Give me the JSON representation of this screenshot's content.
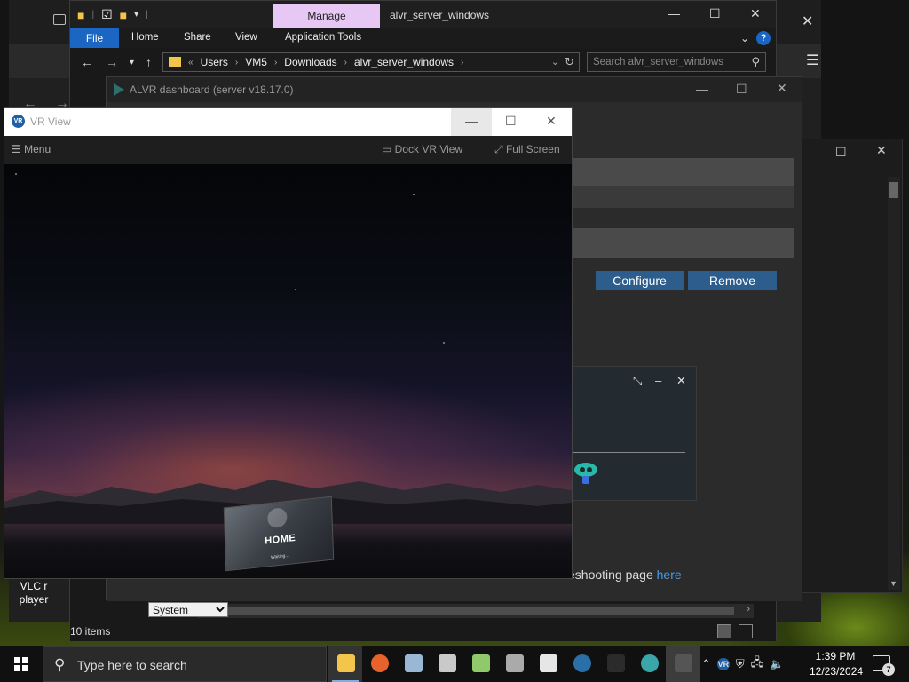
{
  "explorer": {
    "manage_tab": "Manage",
    "title": "alvr_server_windows",
    "ribbon": {
      "file": "File",
      "home": "Home",
      "share": "Share",
      "view": "View",
      "application_tools": "Application Tools"
    },
    "breadcrumbs": [
      "Users",
      "VM5",
      "Downloads",
      "alvr_server_windows"
    ],
    "search_placeholder": "Search alvr_server_windows",
    "status": "10 items"
  },
  "alvr": {
    "title": "ALVR dashboard (server v18.17.0)",
    "configure_label": "Configure",
    "remove_label": "Remove",
    "trouble_prefix": "eshooting page ",
    "trouble_link": "here",
    "language_value": "System"
  },
  "vr_view": {
    "title": "VR View",
    "menu_label": "Menu",
    "dock_label": "Dock VR View",
    "fullscreen_label": "Full Screen",
    "home_label": "HOME",
    "waiting_label": "Waiting..."
  },
  "desktop": {
    "vlc_label_line1": "VLC r",
    "vlc_label_line2": "player"
  },
  "taskbar": {
    "search_placeholder": "Type here to search",
    "time": "1:39 PM",
    "date": "12/23/2024",
    "notification_count": "7",
    "apps": [
      {
        "name": "file-explorer",
        "color": "#f3c54a"
      },
      {
        "name": "firefox",
        "color": "#e8622c"
      },
      {
        "name": "photos",
        "color": "#9ab7d6"
      },
      {
        "name": "package",
        "color": "#c9c9c9"
      },
      {
        "name": "notepad-plus",
        "color": "#8fc96a"
      },
      {
        "name": "installer",
        "color": "#aaaaaa"
      },
      {
        "name": "7zip",
        "color": "#e6e6e6"
      },
      {
        "name": "steam",
        "color": "#2a6fa8"
      },
      {
        "name": "terminal",
        "color": "#2b2b2b"
      },
      {
        "name": "alvr",
        "color": "#3aa6a9"
      },
      {
        "name": "vr-view",
        "color": "#555555"
      }
    ]
  },
  "colors": {
    "accent_blue": "#1a66c2",
    "manage_tab": "#e7c7f3",
    "alvr_button": "#2c5d8c",
    "link": "#4a9be5"
  }
}
